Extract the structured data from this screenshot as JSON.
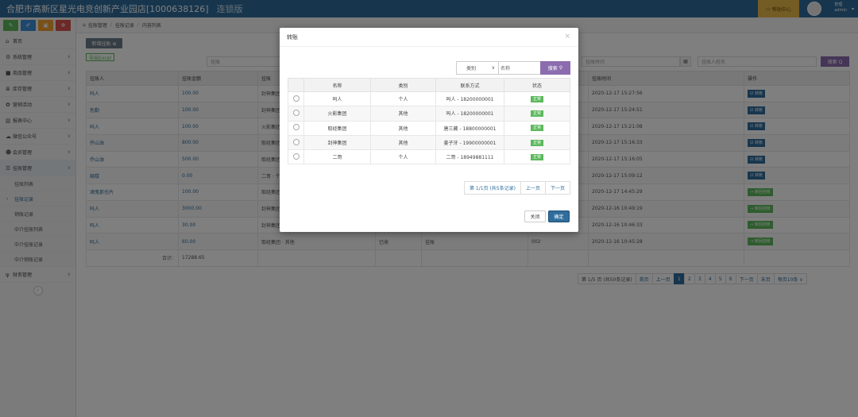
{
  "topbar": {
    "title": "合肥市高新区星光电竞创新产业园店[1000638126]",
    "edition": "连锁版",
    "help": "帮助中心",
    "user_line1": "管理",
    "user_line2": "admin"
  },
  "sidebar": {
    "items": [
      {
        "label": "首页",
        "icon": "home-icon"
      },
      {
        "label": "系统管理",
        "icon": "gear-icon"
      },
      {
        "label": "商品管理",
        "icon": "box-icon"
      },
      {
        "label": "库存管理",
        "icon": "stack-icon"
      },
      {
        "label": "营销活动",
        "icon": "gift-icon"
      },
      {
        "label": "报表中心",
        "icon": "chart-icon"
      },
      {
        "label": "微信公众号",
        "icon": "cloud-icon"
      },
      {
        "label": "会员管理",
        "icon": "users-icon"
      },
      {
        "label": "挂账管理",
        "icon": "list-icon"
      }
    ],
    "sub_items": [
      "挂账列表",
      "挂账记录",
      "销账记录",
      "中介挂账列表",
      "中介挂账记录",
      "中介销账记录"
    ],
    "last_item": {
      "label": "财务管理",
      "icon": "cutlery-icon"
    }
  },
  "breadcrumb": [
    "挂账管理",
    "挂账记录",
    "内容列表"
  ],
  "toolbar": {
    "add_label": "新增挂账 ⊕",
    "export_label": "导出Excel"
  },
  "filters": {
    "placeholder1": "挂账",
    "time_placeholder": "挂账时间",
    "name_placeholder": "挂账人姓名",
    "search_label": "搜索 Q"
  },
  "table": {
    "headers": [
      "挂账人",
      "挂账金额",
      "挂账",
      "",
      "",
      "",
      "挂账时间",
      "操作"
    ],
    "rows": [
      {
        "name": "吗人",
        "amount": "100.00",
        "col3": "封神集团",
        "col4": "",
        "col5": "",
        "col6": "",
        "time": "2020-12-17 15:27:56",
        "op": "☑ 转账",
        "op_type": "blue"
      },
      {
        "name": "危勤",
        "amount": "100.00",
        "col3": "封神集团",
        "col4": "",
        "col5": "",
        "col6": "",
        "time": "2020-12-17 15:24:51",
        "op": "☑ 转账",
        "op_type": "blue"
      },
      {
        "name": "吗人",
        "amount": "100.00",
        "col3": "火影集团",
        "col4": "",
        "col5": "",
        "col6": "",
        "time": "2020-12-17 15:21:08",
        "op": "☑ 转账",
        "op_type": "blue"
      },
      {
        "name": "乔山油",
        "amount": "800.00",
        "col3": "取经集团",
        "col4": "",
        "col5": "",
        "col6": "",
        "time": "2020-12-17 15:16:33",
        "op": "☑ 转账",
        "op_type": "blue"
      },
      {
        "name": "乔山油",
        "amount": "500.00",
        "col3": "取经集团",
        "col4": "",
        "col5": "",
        "col6": "",
        "time": "2020-12-17 15:16:05",
        "op": "☑ 转账",
        "op_type": "blue"
      },
      {
        "name": "碉楼",
        "amount": "0.00",
        "col3": "二哥 · 个",
        "col4": "",
        "col5": "",
        "col6": "",
        "time": "2020-12-17 15:09:12",
        "op": "☑ 转账",
        "op_type": "blue"
      },
      {
        "name": "酒鬼那也片",
        "amount": "100.00",
        "col3": "取经集团",
        "col4": "",
        "col5": "",
        "col6": "",
        "time": "2020-12-17 14:45:29",
        "op": "→ 转回挂账",
        "op_type": "green"
      },
      {
        "name": "吗人",
        "amount": "3000.00",
        "col3": "封神集团",
        "col4": "",
        "col5": "",
        "col6": "",
        "time": "2020-12-16 10:49:19",
        "op": "→ 转回挂账",
        "op_type": "green"
      },
      {
        "name": "吗人",
        "amount": "30.00",
        "col3": "封神集团",
        "col4": "",
        "col5": "",
        "col6": "",
        "time": "2020-12-16 10:46:33",
        "op": "→ 转回挂账",
        "op_type": "green"
      },
      {
        "name": "吗人",
        "amount": "60.00",
        "col3": "取经集团 · 其他",
        "col4": "已收",
        "col5": "挂账",
        "col6": "002",
        "time": "2020-12-16 10:45:28",
        "op": "→ 转回挂账",
        "op_type": "green"
      }
    ],
    "total_label": "合计:",
    "total_value": "17288.65"
  },
  "pager": [
    "第 1/5 页 (共50条记录)",
    "首页",
    "上一页",
    "1",
    "2",
    "3",
    "4",
    "5",
    "6",
    "下一页",
    "末页",
    "每页10条 ∨"
  ],
  "modal": {
    "title": "转账",
    "select_value": "类别",
    "input_placeholder": "名称",
    "search_label": "搜索",
    "headers": [
      "",
      "名称",
      "类别",
      "联系方式",
      "状态"
    ],
    "rows": [
      {
        "name": "吗人",
        "type": "个人",
        "contact": "吗人 - 18200000001",
        "status": "正常"
      },
      {
        "name": "火影集团",
        "type": "其他",
        "contact": "吗人 - 18200000001",
        "status": "正常"
      },
      {
        "name": "取经集团",
        "type": "其他",
        "contact": "唐三藏 - 18800000001",
        "status": "正常"
      },
      {
        "name": "封神集团",
        "type": "其他",
        "contact": "姜子牙 - 19900000001",
        "status": "正常"
      },
      {
        "name": "二哥",
        "type": "个人",
        "contact": "二哥 - 18949881111",
        "status": "正常"
      }
    ],
    "pager": [
      "第 1/1页 (共5条记录)",
      "上一页",
      "下一页"
    ],
    "close_label": "关闭",
    "ok_label": "确定"
  },
  "colors": {
    "brand": "#2f6d9c",
    "accent": "#8b6cae",
    "success": "#5cb85c",
    "help": "#e8b84a"
  }
}
